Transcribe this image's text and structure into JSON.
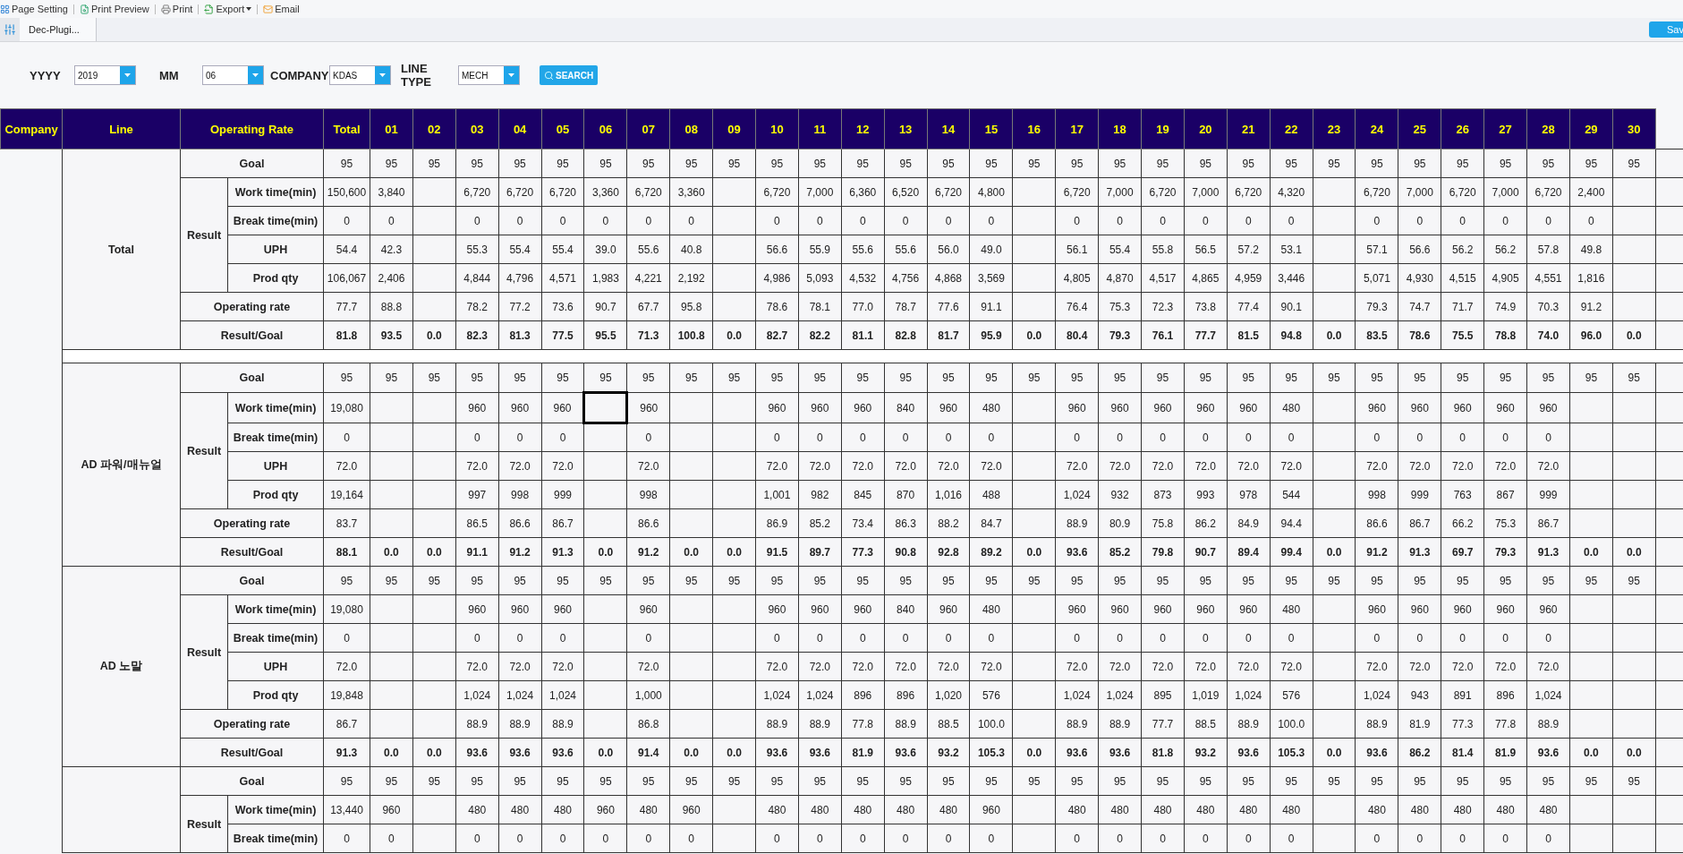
{
  "toolbar": {
    "items": [
      {
        "label": "Page Setting",
        "dropdown": false
      },
      {
        "label": "Print Preview",
        "dropdown": false
      },
      {
        "label": "Print",
        "dropdown": false
      },
      {
        "label": "Export",
        "dropdown": true
      },
      {
        "label": "Email",
        "dropdown": false
      }
    ]
  },
  "tabs": [
    {
      "label": "Dec-Plugi...",
      "selected": true
    }
  ],
  "save_button": "Sav",
  "filters": [
    {
      "label": "YYYY",
      "value": "2019"
    },
    {
      "label": "MM",
      "value": "06"
    },
    {
      "label": "COMPANY",
      "value": "KDAS"
    },
    {
      "label": "LINE TYPE",
      "value": "MECH"
    }
  ],
  "search_button": "SEARCH",
  "table": {
    "columns": [
      "Company",
      "Line",
      "Operating Rate",
      "Total",
      "01",
      "02",
      "03",
      "04",
      "05",
      "06",
      "07",
      "08",
      "09",
      "10",
      "11",
      "12",
      "13",
      "14",
      "15",
      "16",
      "17",
      "18",
      "19",
      "20",
      "21",
      "22",
      "23",
      "24",
      "25",
      "26",
      "27",
      "28",
      "29",
      "30"
    ],
    "groups": [
      {
        "line": "Total",
        "separator": true,
        "items": [
          {
            "label": "Goal",
            "emphasis": false,
            "cells": {
              "total": "95",
              "d01": "95",
              "d02": "95",
              "d03": "95",
              "d04": "95",
              "d05": "95",
              "d06": "95",
              "d07": "95",
              "d08": "95",
              "d09": "95",
              "d10": "95",
              "d11": "95",
              "d12": "95",
              "d13": "95",
              "d14": "95",
              "d15": "95",
              "d16": "95",
              "d17": "95",
              "d18": "95",
              "d19": "95",
              "d20": "95",
              "d21": "95",
              "d22": "95",
              "d23": "95",
              "d24": "95",
              "d25": "95",
              "d26": "95",
              "d27": "95",
              "d28": "95",
              "d29": "95",
              "d30": "95"
            }
          },
          {
            "label": "Result",
            "rows": [
              {
                "label": "Work time(min)",
                "emphasis": false,
                "cells": {
                  "total": "150,600",
                  "d01": "3,840",
                  "d03": "6,720",
                  "d04": "6,720",
                  "d05": "6,720",
                  "d06": "3,360",
                  "d07": "6,720",
                  "d08": "3,360",
                  "d10": "6,720",
                  "d11": "7,000",
                  "d12": "6,360",
                  "d13": "6,520",
                  "d14": "6,720",
                  "d15": "4,800",
                  "d17": "6,720",
                  "d18": "7,000",
                  "d19": "6,720",
                  "d20": "7,000",
                  "d21": "6,720",
                  "d22": "4,320",
                  "d24": "6,720",
                  "d25": "7,000",
                  "d26": "6,720",
                  "d27": "7,000",
                  "d28": "6,720",
                  "d29": "2,400"
                }
              },
              {
                "label": "Break time(min)",
                "emphasis": false,
                "cells": {
                  "total": "0",
                  "d01": "0",
                  "d03": "0",
                  "d04": "0",
                  "d05": "0",
                  "d06": "0",
                  "d07": "0",
                  "d08": "0",
                  "d10": "0",
                  "d11": "0",
                  "d12": "0",
                  "d13": "0",
                  "d14": "0",
                  "d15": "0",
                  "d17": "0",
                  "d18": "0",
                  "d19": "0",
                  "d20": "0",
                  "d21": "0",
                  "d22": "0",
                  "d24": "0",
                  "d25": "0",
                  "d26": "0",
                  "d27": "0",
                  "d28": "0",
                  "d29": "0"
                }
              },
              {
                "label": "UPH",
                "emphasis": false,
                "cells": {
                  "total": "54.4",
                  "d01": "42.3",
                  "d03": "55.3",
                  "d04": "55.4",
                  "d05": "55.4",
                  "d06": "39.0",
                  "d07": "55.6",
                  "d08": "40.8",
                  "d10": "56.6",
                  "d11": "55.9",
                  "d12": "55.6",
                  "d13": "55.6",
                  "d14": "56.0",
                  "d15": "49.0",
                  "d17": "56.1",
                  "d18": "55.4",
                  "d19": "55.8",
                  "d20": "56.5",
                  "d21": "57.2",
                  "d22": "53.1",
                  "d24": "57.1",
                  "d25": "56.6",
                  "d26": "56.2",
                  "d27": "56.2",
                  "d28": "57.8",
                  "d29": "49.8"
                }
              },
              {
                "label": "Prod qty",
                "emphasis": false,
                "cells": {
                  "total": "106,067",
                  "d01": "2,406",
                  "d03": "4,844",
                  "d04": "4,796",
                  "d05": "4,571",
                  "d06": "1,983",
                  "d07": "4,221",
                  "d08": "2,192",
                  "d10": "4,986",
                  "d11": "5,093",
                  "d12": "4,532",
                  "d13": "4,756",
                  "d14": "4,868",
                  "d15": "3,569",
                  "d17": "4,805",
                  "d18": "4,870",
                  "d19": "4,517",
                  "d20": "4,865",
                  "d21": "4,959",
                  "d22": "3,446",
                  "d24": "5,071",
                  "d25": "4,930",
                  "d26": "4,515",
                  "d27": "4,905",
                  "d28": "4,551",
                  "d29": "1,816"
                }
              }
            ]
          },
          {
            "label": "Operating rate",
            "emphasis": false,
            "cells": {
              "total": "77.7",
              "d01": "88.8",
              "d03": "78.2",
              "d04": "77.2",
              "d05": "73.6",
              "d06": "90.7",
              "d07": "67.7",
              "d08": "95.8",
              "d10": "78.6",
              "d11": "78.1",
              "d12": "77.0",
              "d13": "78.7",
              "d14": "77.6",
              "d15": "91.1",
              "d17": "76.4",
              "d18": "75.3",
              "d19": "72.3",
              "d20": "73.8",
              "d21": "77.4",
              "d22": "90.1",
              "d24": "79.3",
              "d25": "74.7",
              "d26": "71.7",
              "d27": "74.9",
              "d28": "70.3",
              "d29": "91.2"
            }
          },
          {
            "label": "Result/Goal",
            "emphasis": true,
            "cells": {
              "total": "81.8",
              "d01": "93.5",
              "d02": "0.0",
              "d03": "82.3",
              "d04": "81.3",
              "d05": "77.5",
              "d06": "95.5",
              "d07": "71.3",
              "d08": "100.8",
              "d09": "0.0",
              "d10": "82.7",
              "d11": "82.2",
              "d12": "81.1",
              "d13": "82.8",
              "d14": "81.7",
              "d15": "95.9",
              "d16": "0.0",
              "d17": "80.4",
              "d18": "79.3",
              "d19": "76.1",
              "d20": "77.7",
              "d21": "81.5",
              "d22": "94.8",
              "d23": "0.0",
              "d24": "83.5",
              "d25": "78.6",
              "d26": "75.5",
              "d27": "78.8",
              "d28": "74.0",
              "d29": "96.0",
              "d30": "0.0"
            }
          }
        ]
      },
      {
        "line": "AD 파워/매뉴얼",
        "separator": false,
        "items": [
          {
            "label": "Goal",
            "emphasis": false,
            "cells": {
              "total": "95",
              "d01": "95",
              "d02": "95",
              "d03": "95",
              "d04": "95",
              "d05": "95",
              "d06": "95",
              "d07": "95",
              "d08": "95",
              "d09": "95",
              "d10": "95",
              "d11": "95",
              "d12": "95",
              "d13": "95",
              "d14": "95",
              "d15": "95",
              "d16": "95",
              "d17": "95",
              "d18": "95",
              "d19": "95",
              "d20": "95",
              "d21": "95",
              "d22": "95",
              "d23": "95",
              "d24": "95",
              "d25": "95",
              "d26": "95",
              "d27": "95",
              "d28": "95",
              "d29": "95",
              "d30": "95"
            }
          },
          {
            "label": "Result",
            "rows": [
              {
                "label": "Work time(min)",
                "emphasis": false,
                "cells": {
                  "total": "19,080",
                  "d03": "960",
                  "d04": "960",
                  "d05": "960",
                  "d06": {
                    "selected": true
                  },
                  "d07": "960",
                  "d10": "960",
                  "d11": "960",
                  "d12": "960",
                  "d13": "840",
                  "d14": "960",
                  "d15": "480",
                  "d17": "960",
                  "d18": "960",
                  "d19": "960",
                  "d20": "960",
                  "d21": "960",
                  "d22": "480",
                  "d24": "960",
                  "d25": "960",
                  "d26": "960",
                  "d27": "960",
                  "d28": "960"
                }
              },
              {
                "label": "Break time(min)",
                "emphasis": false,
                "cells": {
                  "total": "0",
                  "d03": "0",
                  "d04": "0",
                  "d05": "0",
                  "d07": "0",
                  "d10": "0",
                  "d11": "0",
                  "d12": "0",
                  "d13": "0",
                  "d14": "0",
                  "d15": "0",
                  "d17": "0",
                  "d18": "0",
                  "d19": "0",
                  "d20": "0",
                  "d21": "0",
                  "d22": "0",
                  "d24": "0",
                  "d25": "0",
                  "d26": "0",
                  "d27": "0",
                  "d28": "0"
                }
              },
              {
                "label": "UPH",
                "emphasis": false,
                "cells": {
                  "total": "72.0",
                  "d03": "72.0",
                  "d04": "72.0",
                  "d05": "72.0",
                  "d07": "72.0",
                  "d10": "72.0",
                  "d11": "72.0",
                  "d12": "72.0",
                  "d13": "72.0",
                  "d14": "72.0",
                  "d15": "72.0",
                  "d17": "72.0",
                  "d18": "72.0",
                  "d19": "72.0",
                  "d20": "72.0",
                  "d21": "72.0",
                  "d22": "72.0",
                  "d24": "72.0",
                  "d25": "72.0",
                  "d26": "72.0",
                  "d27": "72.0",
                  "d28": "72.0"
                }
              },
              {
                "label": "Prod qty",
                "emphasis": false,
                "cells": {
                  "total": "19,164",
                  "d03": "997",
                  "d04": "998",
                  "d05": "999",
                  "d07": "998",
                  "d10": "1,001",
                  "d11": "982",
                  "d12": "845",
                  "d13": "870",
                  "d14": "1,016",
                  "d15": "488",
                  "d17": "1,024",
                  "d18": "932",
                  "d19": "873",
                  "d20": "993",
                  "d21": "978",
                  "d22": "544",
                  "d24": "998",
                  "d25": "999",
                  "d26": "763",
                  "d27": "867",
                  "d28": "999"
                }
              }
            ]
          },
          {
            "label": "Operating rate",
            "emphasis": false,
            "cells": {
              "total": "83.7",
              "d03": "86.5",
              "d04": "86.6",
              "d05": "86.7",
              "d07": "86.6",
              "d10": "86.9",
              "d11": "85.2",
              "d12": "73.4",
              "d13": "86.3",
              "d14": "88.2",
              "d15": "84.7",
              "d17": "88.9",
              "d18": "80.9",
              "d19": "75.8",
              "d20": "86.2",
              "d21": "84.9",
              "d22": "94.4",
              "d24": "86.6",
              "d25": "86.7",
              "d26": "66.2",
              "d27": "75.3",
              "d28": "86.7"
            }
          },
          {
            "label": "Result/Goal",
            "emphasis": true,
            "cells": {
              "total": "88.1",
              "d01": "0.0",
              "d02": "0.0",
              "d03": "91.1",
              "d04": "91.2",
              "d05": "91.3",
              "d06": "0.0",
              "d07": "91.2",
              "d08": "0.0",
              "d09": "0.0",
              "d10": "91.5",
              "d11": "89.7",
              "d12": "77.3",
              "d13": "90.8",
              "d14": "92.8",
              "d15": "89.2",
              "d16": "0.0",
              "d17": "93.6",
              "d18": "85.2",
              "d19": "79.8",
              "d20": "90.7",
              "d21": "89.4",
              "d22": "99.4",
              "d23": "0.0",
              "d24": "91.2",
              "d25": "91.3",
              "d26": "69.7",
              "d27": "79.3",
              "d28": "91.3",
              "d29": "0.0",
              "d30": "0.0"
            }
          }
        ]
      },
      {
        "line": "AD 노말",
        "separator": false,
        "items": [
          {
            "label": "Goal",
            "emphasis": false,
            "cells": {
              "total": "95",
              "d01": "95",
              "d02": "95",
              "d03": "95",
              "d04": "95",
              "d05": "95",
              "d06": "95",
              "d07": "95",
              "d08": "95",
              "d09": "95",
              "d10": "95",
              "d11": "95",
              "d12": "95",
              "d13": "95",
              "d14": "95",
              "d15": "95",
              "d16": "95",
              "d17": "95",
              "d18": "95",
              "d19": "95",
              "d20": "95",
              "d21": "95",
              "d22": "95",
              "d23": "95",
              "d24": "95",
              "d25": "95",
              "d26": "95",
              "d27": "95",
              "d28": "95",
              "d29": "95",
              "d30": "95"
            }
          },
          {
            "label": "Result",
            "rows": [
              {
                "label": "Work time(min)",
                "emphasis": false,
                "cells": {
                  "total": "19,080",
                  "d03": "960",
                  "d04": "960",
                  "d05": "960",
                  "d07": "960",
                  "d10": "960",
                  "d11": "960",
                  "d12": "960",
                  "d13": "840",
                  "d14": "960",
                  "d15": "480",
                  "d17": "960",
                  "d18": "960",
                  "d19": "960",
                  "d20": "960",
                  "d21": "960",
                  "d22": "480",
                  "d24": "960",
                  "d25": "960",
                  "d26": "960",
                  "d27": "960",
                  "d28": "960"
                }
              },
              {
                "label": "Break time(min)",
                "emphasis": false,
                "cells": {
                  "total": "0",
                  "d03": "0",
                  "d04": "0",
                  "d05": "0",
                  "d07": "0",
                  "d10": "0",
                  "d11": "0",
                  "d12": "0",
                  "d13": "0",
                  "d14": "0",
                  "d15": "0",
                  "d17": "0",
                  "d18": "0",
                  "d19": "0",
                  "d20": "0",
                  "d21": "0",
                  "d22": "0",
                  "d24": "0",
                  "d25": "0",
                  "d26": "0",
                  "d27": "0",
                  "d28": "0"
                }
              },
              {
                "label": "UPH",
                "emphasis": false,
                "cells": {
                  "total": "72.0",
                  "d03": "72.0",
                  "d04": "72.0",
                  "d05": "72.0",
                  "d07": "72.0",
                  "d10": "72.0",
                  "d11": "72.0",
                  "d12": "72.0",
                  "d13": "72.0",
                  "d14": "72.0",
                  "d15": "72.0",
                  "d17": "72.0",
                  "d18": "72.0",
                  "d19": "72.0",
                  "d20": "72.0",
                  "d21": "72.0",
                  "d22": "72.0",
                  "d24": "72.0",
                  "d25": "72.0",
                  "d26": "72.0",
                  "d27": "72.0",
                  "d28": "72.0"
                }
              },
              {
                "label": "Prod qty",
                "emphasis": false,
                "cells": {
                  "total": "19,848",
                  "d03": "1,024",
                  "d04": "1,024",
                  "d05": "1,024",
                  "d07": "1,000",
                  "d10": "1,024",
                  "d11": "1,024",
                  "d12": "896",
                  "d13": "896",
                  "d14": "1,020",
                  "d15": "576",
                  "d17": "1,024",
                  "d18": "1,024",
                  "d19": "895",
                  "d20": "1,019",
                  "d21": "1,024",
                  "d22": "576",
                  "d24": "1,024",
                  "d25": "943",
                  "d26": "891",
                  "d27": "896",
                  "d28": "1,024"
                }
              }
            ]
          },
          {
            "label": "Operating rate",
            "emphasis": false,
            "cells": {
              "total": "86.7",
              "d03": "88.9",
              "d04": "88.9",
              "d05": "88.9",
              "d07": "86.8",
              "d10": "88.9",
              "d11": "88.9",
              "d12": "77.8",
              "d13": "88.9",
              "d14": "88.5",
              "d15": "100.0",
              "d17": "88.9",
              "d18": "88.9",
              "d19": "77.7",
              "d20": "88.5",
              "d21": "88.9",
              "d22": "100.0",
              "d24": "88.9",
              "d25": "81.9",
              "d26": "77.3",
              "d27": "77.8",
              "d28": "88.9"
            }
          },
          {
            "label": "Result/Goal",
            "emphasis": true,
            "cells": {
              "total": "91.3",
              "d01": "0.0",
              "d02": "0.0",
              "d03": "93.6",
              "d04": "93.6",
              "d05": "93.6",
              "d06": "0.0",
              "d07": "91.4",
              "d08": "0.0",
              "d09": "0.0",
              "d10": "93.6",
              "d11": "93.6",
              "d12": "81.9",
              "d13": "93.6",
              "d14": "93.2",
              "d15": "105.3",
              "d16": "0.0",
              "d17": "93.6",
              "d18": "93.6",
              "d19": "81.8",
              "d20": "93.2",
              "d21": "93.6",
              "d22": "105.3",
              "d23": "0.0",
              "d24": "93.6",
              "d25": "86.2",
              "d26": "81.4",
              "d27": "81.9",
              "d28": "93.6",
              "d29": "0.0",
              "d30": "0.0"
            }
          }
        ]
      },
      {
        "separator": false,
        "items": [
          {
            "label": "Goal",
            "emphasis": false,
            "cells": {
              "total": "95",
              "d01": "95",
              "d02": "95",
              "d03": "95",
              "d04": "95",
              "d05": "95",
              "d06": "95",
              "d07": "95",
              "d08": "95",
              "d09": "95",
              "d10": "95",
              "d11": "95",
              "d12": "95",
              "d13": "95",
              "d14": "95",
              "d15": "95",
              "d16": "95",
              "d17": "95",
              "d18": "95",
              "d19": "95",
              "d20": "95",
              "d21": "95",
              "d22": "95",
              "d23": "95",
              "d24": "95",
              "d25": "95",
              "d26": "95",
              "d27": "95",
              "d28": "95",
              "d29": "95",
              "d30": "95"
            }
          },
          {
            "label": "Result",
            "rows": [
              {
                "label": "Work time(min)",
                "emphasis": false,
                "cells": {
                  "total": "13,440",
                  "d01": "960",
                  "d03": "480",
                  "d04": "480",
                  "d05": "480",
                  "d06": "960",
                  "d07": "480",
                  "d08": "960",
                  "d10": "480",
                  "d11": "480",
                  "d12": "480",
                  "d13": "480",
                  "d14": "480",
                  "d15": "960",
                  "d17": "480",
                  "d18": "480",
                  "d19": "480",
                  "d20": "480",
                  "d21": "480",
                  "d22": "480",
                  "d24": "480",
                  "d25": "480",
                  "d26": "480",
                  "d27": "480",
                  "d28": "480"
                }
              },
              {
                "label": "Break time(min)",
                "emphasis": false,
                "cells": {
                  "total": "0",
                  "d01": "0",
                  "d03": "0",
                  "d04": "0",
                  "d05": "0",
                  "d06": "0",
                  "d07": "0",
                  "d08": "0",
                  "d10": "0",
                  "d11": "0",
                  "d12": "0",
                  "d13": "0",
                  "d14": "0",
                  "d15": "0",
                  "d17": "0",
                  "d18": "0",
                  "d19": "0",
                  "d20": "0",
                  "d21": "0",
                  "d22": "0",
                  "d24": "0",
                  "d25": "0",
                  "d26": "0",
                  "d27": "0",
                  "d28": "0"
                }
              }
            ]
          }
        ]
      }
    ]
  }
}
